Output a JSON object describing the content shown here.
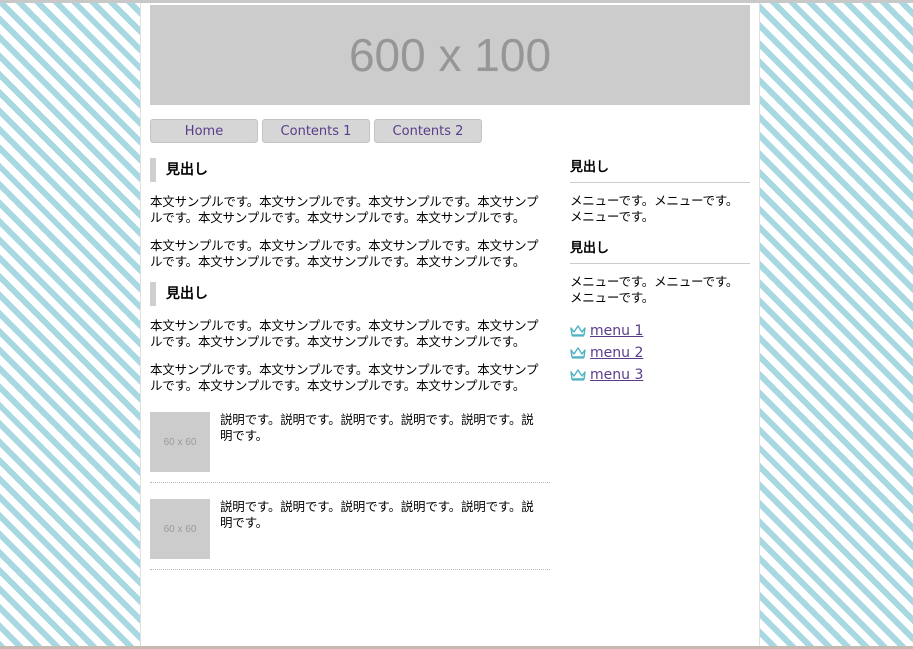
{
  "banner": {
    "text": "600 x 100"
  },
  "nav": {
    "items": [
      {
        "label": "Home"
      },
      {
        "label": "Contents 1"
      },
      {
        "label": "Contents 2"
      }
    ]
  },
  "main": {
    "sections": [
      {
        "heading": "見出し",
        "paragraphs": [
          "本文サンプルです。本文サンプルです。本文サンプルです。本文サンプルです。本文サンプルです。本文サンプルです。本文サンプルです。",
          "本文サンプルです。本文サンプルです。本文サンプルです。本文サンプルです。本文サンプルです。本文サンプルです。本文サンプルです。"
        ]
      },
      {
        "heading": "見出し",
        "paragraphs": [
          "本文サンプルです。本文サンプルです。本文サンプルです。本文サンプルです。本文サンプルです。本文サンプルです。本文サンプルです。",
          "本文サンプルです。本文サンプルです。本文サンプルです。本文サンプルです。本文サンプルです。本文サンプルです。本文サンプルです。"
        ]
      }
    ],
    "thumbnails": [
      {
        "image_text": "60 x 60",
        "description": "説明です。説明です。説明です。説明です。説明です。説明です。"
      },
      {
        "image_text": "60 x 60",
        "description": "説明です。説明です。説明です。説明です。説明です。説明です。"
      }
    ]
  },
  "side": {
    "blocks": [
      {
        "heading": "見出し",
        "text": "メニューです。メニューです。メニューです。"
      },
      {
        "heading": "見出し",
        "text": "メニューです。メニューです。メニューです。"
      }
    ],
    "menu": [
      {
        "label": "menu 1",
        "icon": "crown-icon"
      },
      {
        "label": "menu 2",
        "icon": "crown-icon"
      },
      {
        "label": "menu 3",
        "icon": "crown-icon"
      }
    ]
  },
  "colors": {
    "stripe": "#a8d8e2",
    "link": "#5a3c8a",
    "placeholder_bg": "#cccccc",
    "crown": "#4fb3c4"
  }
}
